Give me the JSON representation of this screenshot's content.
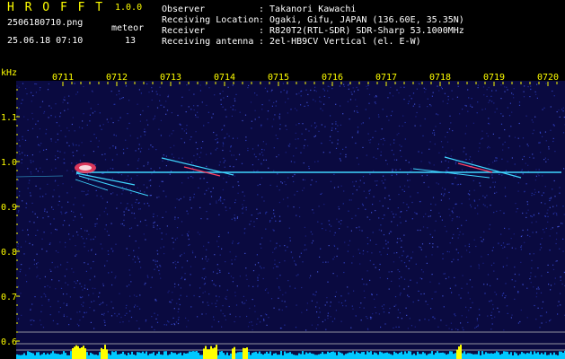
{
  "header": {
    "app_letters": "H R O F F T",
    "version": "1.0.0",
    "filename": "2506180710.png",
    "meteor_label": "meteor",
    "datetime": "25.06.18 07:10",
    "meteor_count": "13",
    "info": [
      {
        "label": "Observer",
        "value": ": Takanori Kawachi"
      },
      {
        "label": "Receiving Location",
        "value": ": Ogaki, Gifu, JAPAN (136.60E, 35.35N)"
      },
      {
        "label": "Receiver",
        "value": ": R820T2(RTL-SDR) SDR-Sharp 53.1000MHz"
      },
      {
        "label": "Receiving antenna",
        "value": ": 2el-HB9CV Vertical (el. E-W)"
      }
    ]
  },
  "spectrogram": {
    "unit": "kHz",
    "time_ticks": [
      "0711",
      "0712",
      "0713",
      "0714",
      "0715",
      "0716",
      "0717",
      "0718",
      "0719",
      "0720"
    ],
    "freq_ticks": [
      "1.1",
      "1.0",
      "0.9",
      "0.8",
      "0.7",
      "0.6"
    ],
    "colors": {
      "background": "#0a0a40",
      "signal": "#3fd6ff",
      "hot": "#ff4060",
      "level": "#00c8ff",
      "peak": "#ffff00"
    }
  }
}
